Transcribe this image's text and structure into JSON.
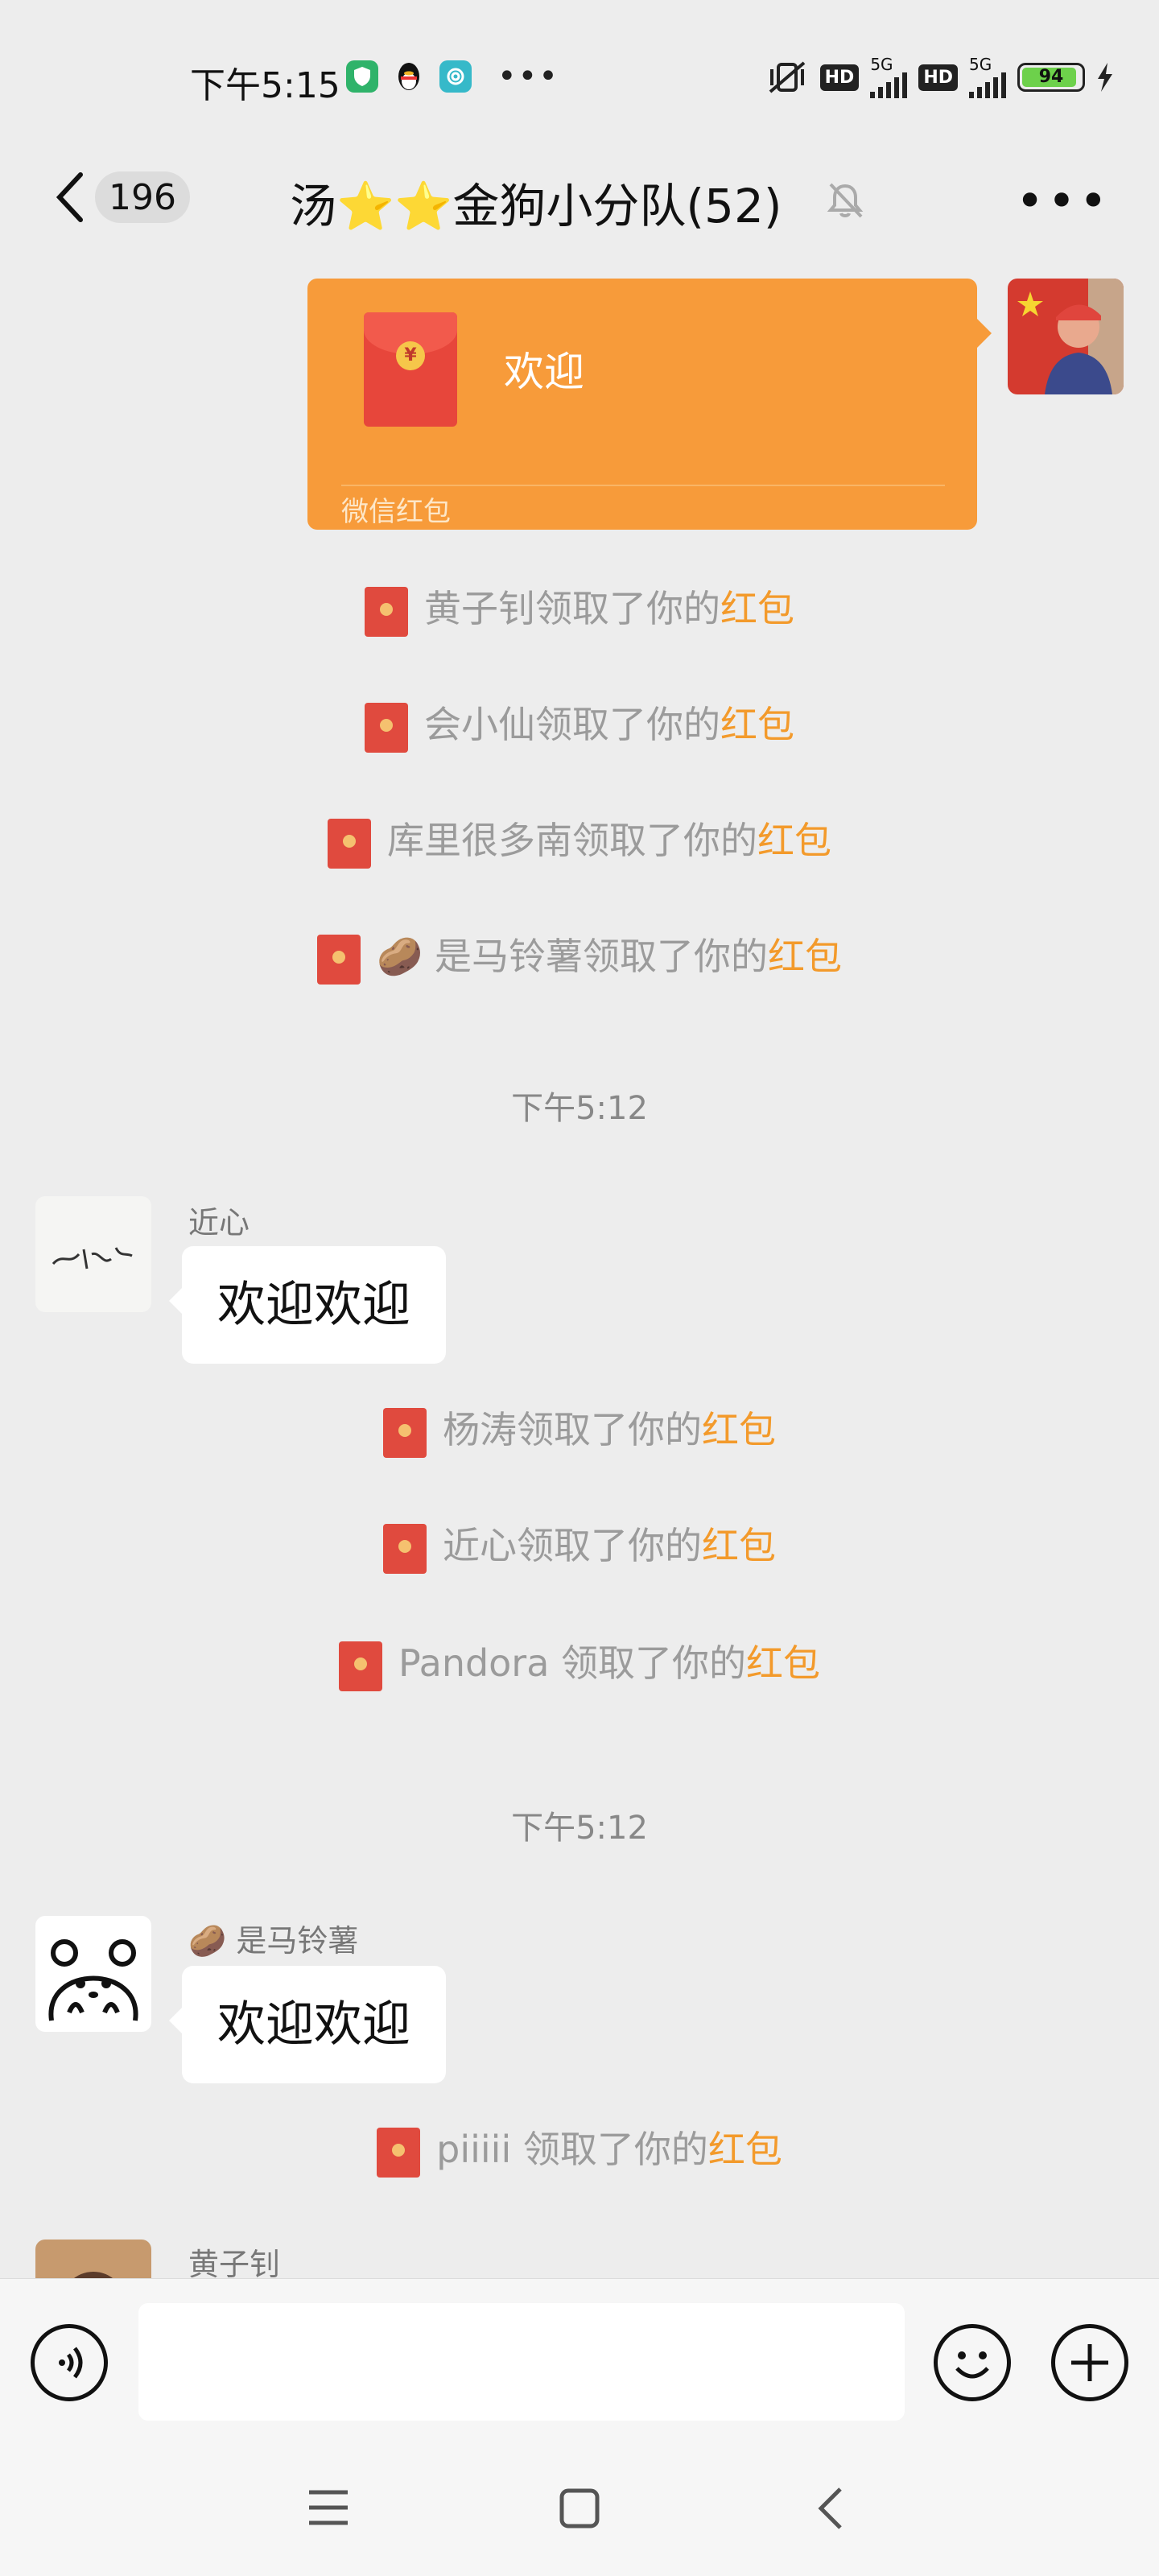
{
  "status_bar": {
    "time": "下午5:15",
    "hd_label": "HD",
    "net1": "5G",
    "net2": "5G",
    "battery_percent": "94",
    "battery_level": 0.94
  },
  "header": {
    "unread_count": "196",
    "title": "汤⭐⭐金狗小分队(52)"
  },
  "messages": {
    "red_packet": {
      "text": "欢迎",
      "footer": "微信红包"
    },
    "sys1": {
      "name": "黄子钊",
      "suffix": "领取了你的",
      "link": "红包"
    },
    "sys2": {
      "name": "会小仙",
      "suffix": "领取了你的",
      "link": "红包"
    },
    "sys3": {
      "name": "库里很多南",
      "suffix": "领取了你的",
      "link": "红包"
    },
    "sys4": {
      "name": "🥔 是马铃薯",
      "suffix": "领取了你的",
      "link": "红包"
    },
    "time1": "下午5:12",
    "msg1": {
      "sender": "近心",
      "text": "欢迎欢迎"
    },
    "sys5": {
      "name": "杨涛",
      "suffix": "领取了你的",
      "link": "红包"
    },
    "sys6": {
      "name": "近心",
      "suffix": "领取了你的",
      "link": "红包"
    },
    "sys7": {
      "name": "Pandora ",
      "suffix": "领取了你的",
      "link": "红包"
    },
    "time2": "下午5:12",
    "msg2": {
      "sender": "🥔 是马铃薯",
      "text": "欢迎欢迎"
    },
    "sys8": {
      "name": "piiiii ",
      "suffix": "领取了你的",
      "link": "红包"
    },
    "msg3": {
      "sender": "黄子钊"
    }
  },
  "colors": {
    "red_packet_bg": "#f79b3a",
    "highlight": "#f39a2b",
    "chat_bg": "#ededed"
  },
  "icons": {
    "back": "chevron-left-icon",
    "mute": "bell-off-icon",
    "more": "more-dots-icon",
    "voice": "voice-icon",
    "emoji": "emoji-icon",
    "plus": "plus-icon"
  }
}
